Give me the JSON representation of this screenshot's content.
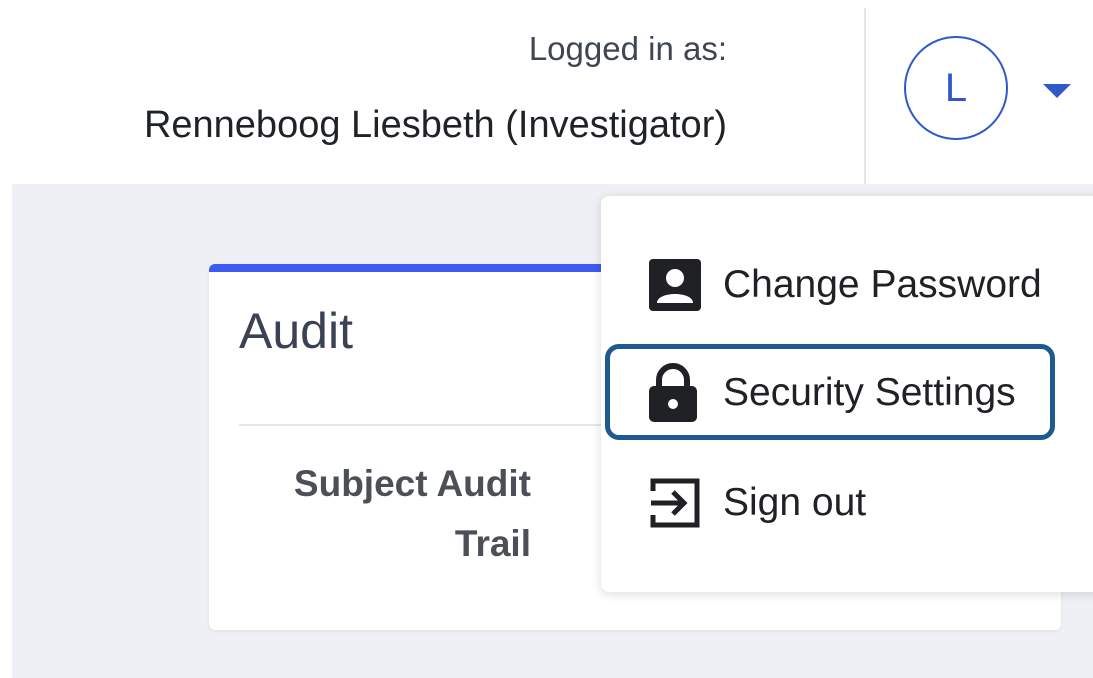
{
  "header": {
    "logged_in_label": "Logged in as:",
    "user_name": "Renneboog Liesbeth (Investigator)",
    "avatar_initial": "L",
    "dropdown_icon": "chevron-down-icon"
  },
  "card": {
    "title": "Audit",
    "link_line1": "Subject Audit",
    "link_line2": "Trail"
  },
  "user_menu": {
    "items": [
      {
        "label": "Change Password",
        "icon": "person-badge-icon"
      },
      {
        "label": "Security Settings",
        "icon": "lock-icon",
        "highlighted": true
      },
      {
        "label": "Sign out",
        "icon": "sign-out-icon"
      }
    ]
  },
  "colors": {
    "accent": "#3d5bf0",
    "avatar": "#2f58c9",
    "highlight_border": "#1d5a8f",
    "background": "#eef0f5"
  }
}
